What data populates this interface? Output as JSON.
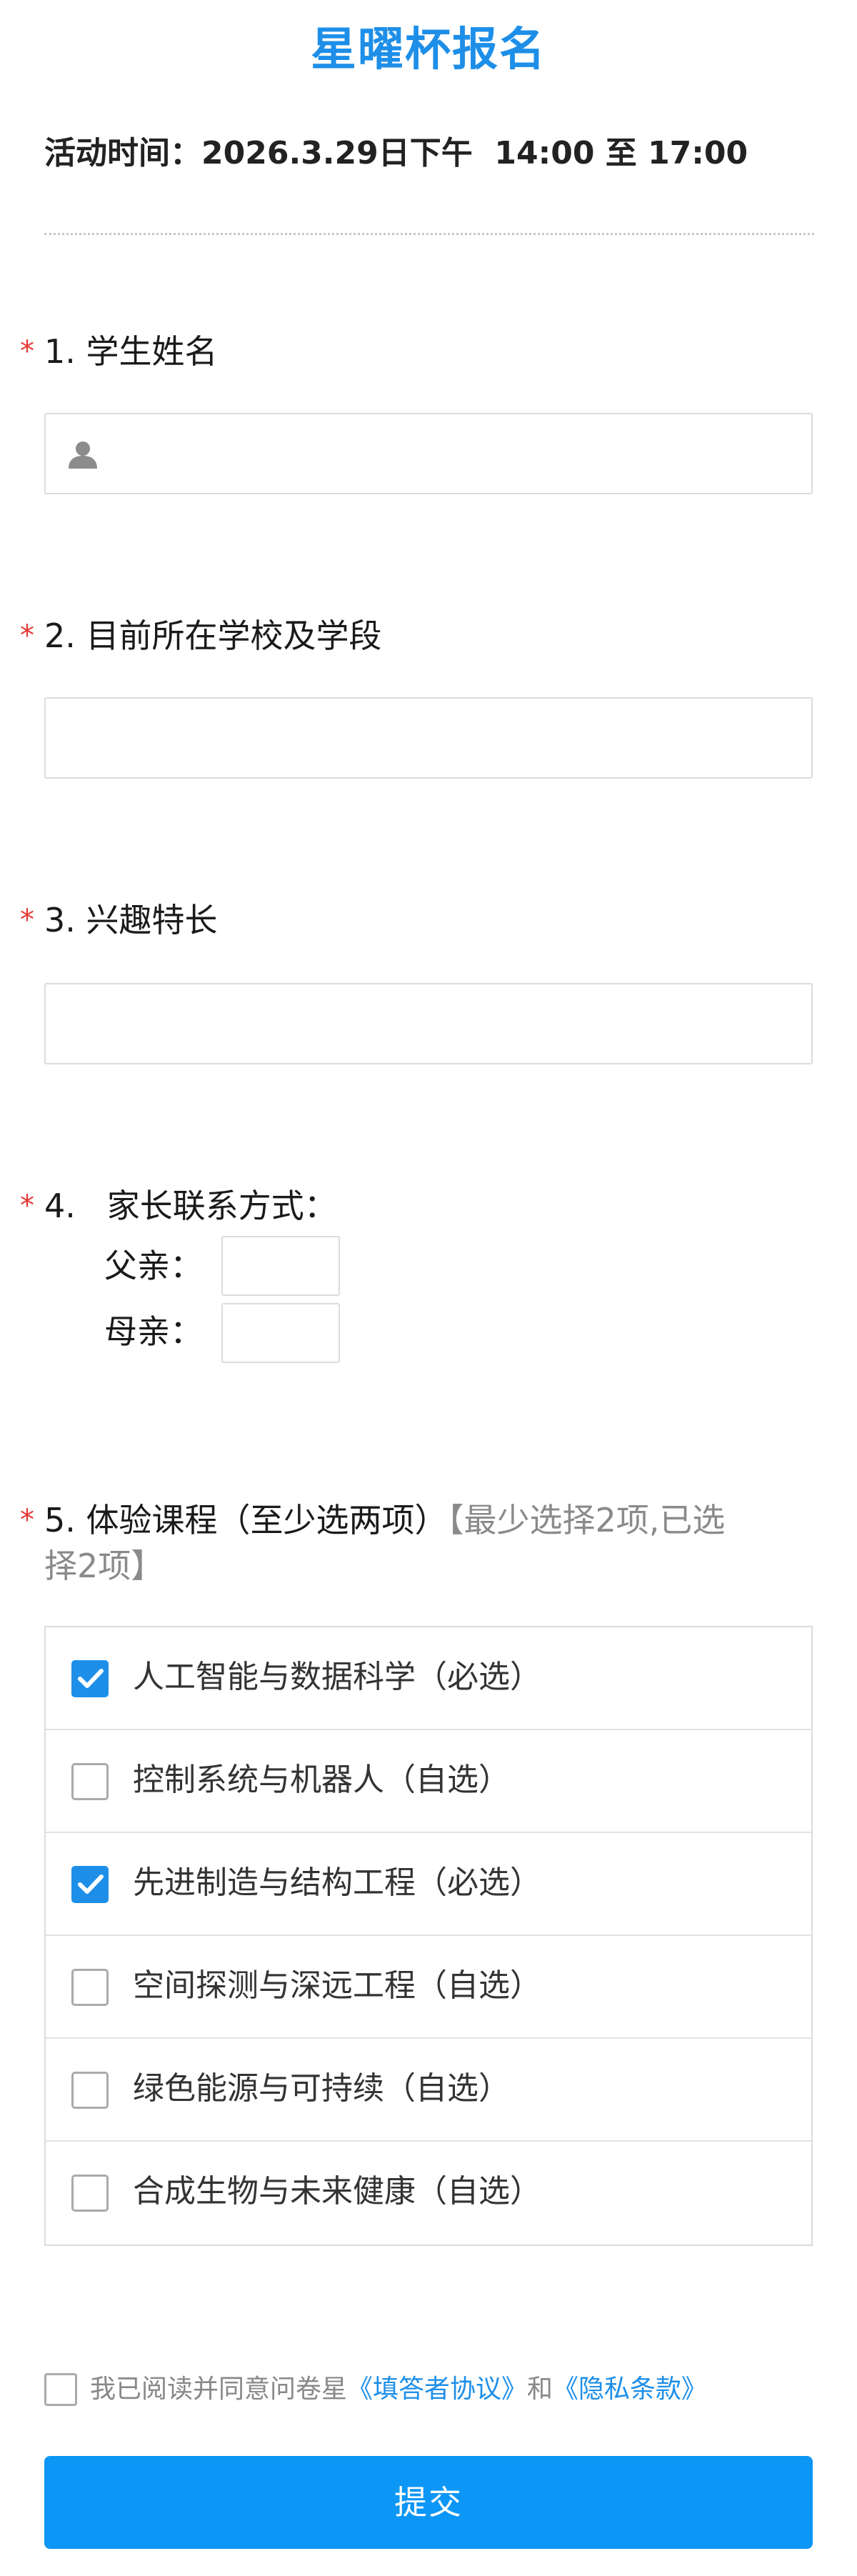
{
  "title": "星曜杯报名",
  "activity_time": "活动时间：2026.3.29日下午  14:00 至 17:00",
  "questions": [
    {
      "label": "1. 学生姓名"
    },
    {
      "label": "2. 目前所在学校及学段"
    },
    {
      "label": "3. 兴趣特长"
    },
    {
      "label": "4.   家长联系方式：",
      "father": "父亲：",
      "mother": "母亲："
    },
    {
      "label": "5. 体验课程（至少选两项）",
      "hint_line1": "【最少选择2项,已选",
      "hint_line2": "择2项】"
    }
  ],
  "courses": [
    {
      "label": "人工智能与数据科学（必选）",
      "checked": true
    },
    {
      "label": "控制系统与机器人（自选）",
      "checked": false
    },
    {
      "label": "先进制造与结构工程（必选）",
      "checked": true
    },
    {
      "label": "空间探测与深远工程（自选）",
      "checked": false
    },
    {
      "label": "绿色能源与可持续（自选）",
      "checked": false
    },
    {
      "label": "合成生物与未来健康（自选）",
      "checked": false
    }
  ],
  "agreement": {
    "prefix": "我已阅读并同意问卷星",
    "link1": "《填答者协议》",
    "middle": "和",
    "link2": "《隐私条款》"
  },
  "submit_label": "提交",
  "colors": {
    "accent": "#1e8fe8",
    "required": "#e53935",
    "button": "#0c96f5"
  }
}
